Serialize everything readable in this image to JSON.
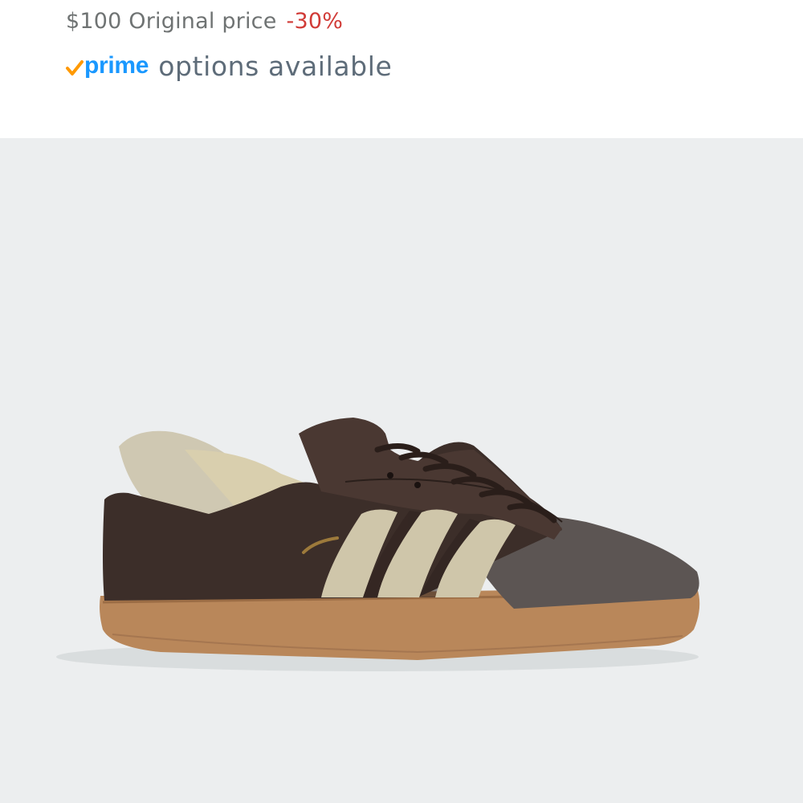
{
  "price": {
    "original": "$100 Original price",
    "discount": "-30%"
  },
  "prime": {
    "logo_text": "prime",
    "text": "options available",
    "check_icon": "check-icon",
    "colors": {
      "check": "#ff9900",
      "logo": "#1a98ff"
    }
  },
  "product_image": {
    "background_color": "#eceeef",
    "subject": "shoe-image"
  }
}
